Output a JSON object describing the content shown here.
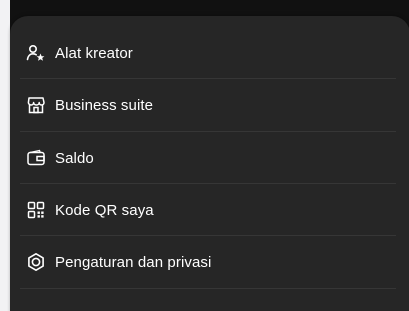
{
  "menu": {
    "items": [
      {
        "label": "Alat kreator",
        "icon": "creator-tools-icon"
      },
      {
        "label": "Business suite",
        "icon": "storefront-icon"
      },
      {
        "label": "Saldo",
        "icon": "wallet-icon"
      },
      {
        "label": "Kode QR saya",
        "icon": "qr-code-icon"
      },
      {
        "label": "Pengaturan dan privasi",
        "icon": "settings-icon"
      }
    ]
  },
  "colors": {
    "sheet_background": "#262626",
    "divider": "#363636",
    "text": "#ffffff"
  }
}
